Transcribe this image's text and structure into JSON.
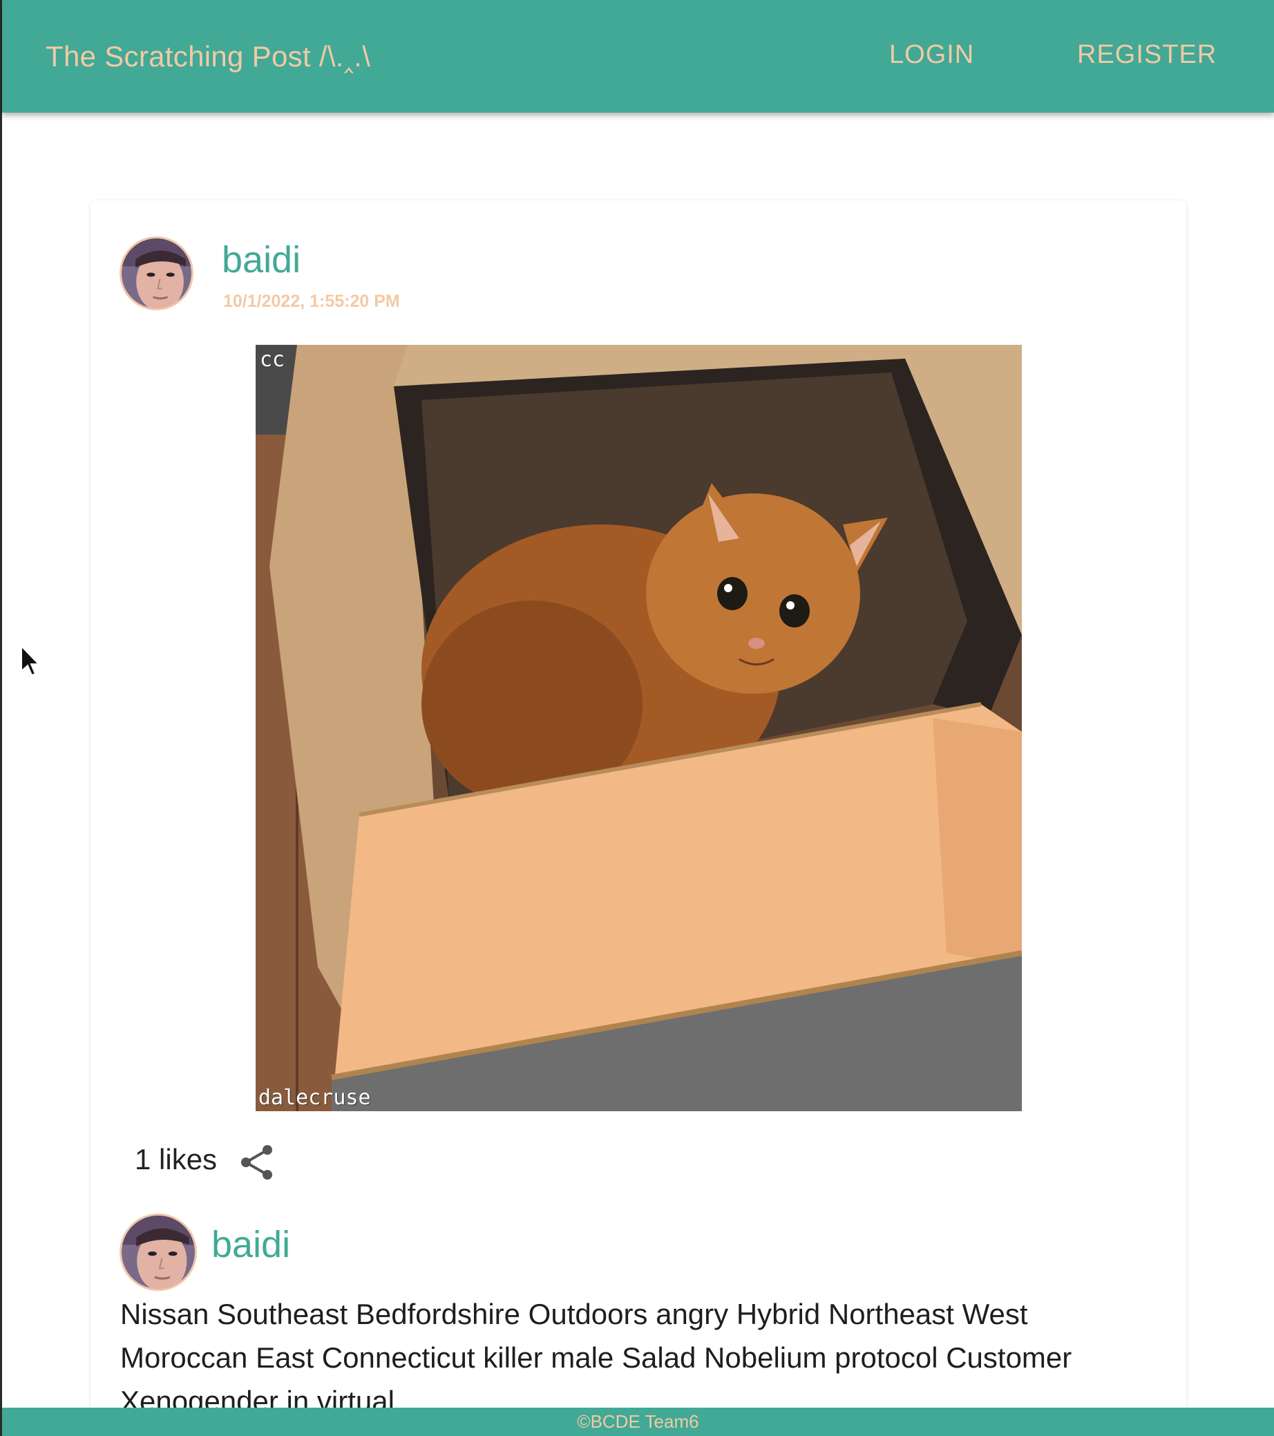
{
  "header": {
    "brand": "The Scratching Post /\\.‸.\\",
    "login": "LOGIN",
    "register": "REGISTER"
  },
  "post": {
    "author": "baidi",
    "timestamp": "10/1/2022, 1:55:20 PM",
    "image": {
      "subject": "orange tabby cat inside cardboard box",
      "corner_tag": "cc",
      "credit_tag": "dalecruse"
    },
    "likes": "1 likes"
  },
  "comment": {
    "author": "baidi",
    "text": "Nissan Southeast Bedfordshire Outdoors angry Hybrid Northeast West Moroccan East Connecticut killer male Salad Nobelium protocol Customer Xenogender in virtual"
  },
  "footer": {
    "copyright": "©BCDE Team6"
  },
  "colors": {
    "primary": "#41a996",
    "accent": "#f3c9a4"
  },
  "icons": [
    "share-icon",
    "avatar",
    "mouse-cursor-icon"
  ]
}
